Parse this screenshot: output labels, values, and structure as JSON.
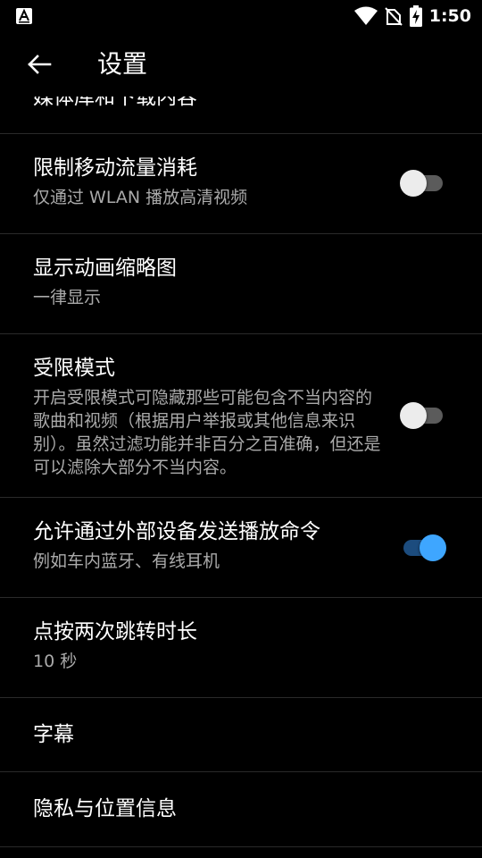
{
  "status_bar": {
    "time": "1:50",
    "left_icon": "font-a-icon",
    "icons": [
      "wifi-icon",
      "no-sim-icon",
      "battery-charging-icon"
    ]
  },
  "app_bar": {
    "back_icon": "arrow-left-icon",
    "title": "设置"
  },
  "settings": [
    {
      "title": "媒体库和下载内容",
      "subtitle": "",
      "toggle": null
    },
    {
      "title": "限制移动流量消耗",
      "subtitle": "仅通过 WLAN 播放高清视频",
      "toggle": false
    },
    {
      "title": "显示动画缩略图",
      "subtitle": "一律显示",
      "toggle": null
    },
    {
      "title": "受限模式",
      "subtitle": "开启受限模式可隐藏那些可能包含不当内容的歌曲和视频（根据用户举报或其他信息来识别）。虽然过滤功能并非百分之百准确，但还是可以滤除大部分不当内容。",
      "toggle": false
    },
    {
      "title": "允许通过外部设备发送播放命令",
      "subtitle": "例如车内蓝牙、有线耳机",
      "toggle": true
    },
    {
      "title": "点按两次跳转时长",
      "subtitle": "10 秒",
      "toggle": null
    },
    {
      "title": "字幕",
      "subtitle": "",
      "toggle": null
    },
    {
      "title": "隐私与位置信息",
      "subtitle": "",
      "toggle": null
    }
  ],
  "colors": {
    "background": "#000000",
    "text_primary": "#ffffff",
    "text_secondary": "#aaaaaa",
    "divider": "#2a2a2a",
    "toggle_on_thumb": "#3ea6ff",
    "toggle_on_track": "#1c4c7e",
    "toggle_off_thumb": "#ececec",
    "toggle_off_track": "#5b5b5b"
  }
}
